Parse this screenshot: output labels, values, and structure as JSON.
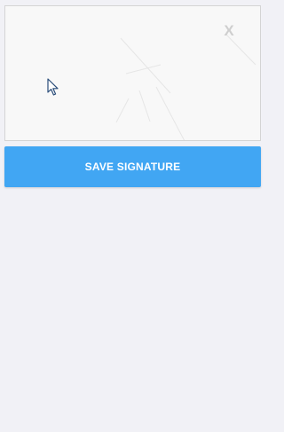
{
  "signature_pad": {
    "clear_label": "X"
  },
  "actions": {
    "save_label": "SAVE SIGNATURE"
  },
  "icons": {
    "cursor": "mouse-pointer-icon"
  },
  "colors": {
    "background": "#f1f1f6",
    "pad_background": "#f8f8f8",
    "pad_border": "#d4d4d4",
    "primary_button": "#41a6f3",
    "button_text": "#ffffff",
    "clear_text": "#cfcfcf"
  }
}
